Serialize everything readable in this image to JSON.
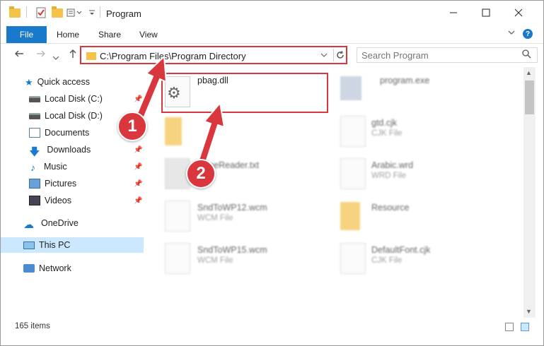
{
  "window": {
    "title": "Program"
  },
  "ribbon": {
    "file": "File",
    "tabs": [
      "Home",
      "Share",
      "View"
    ],
    "help": "?"
  },
  "address": {
    "path": "C:\\Program Files\\Program Directory",
    "search_placeholder": "Search Program"
  },
  "sidebar": {
    "items": [
      {
        "label": "Quick access",
        "icon": "star-icon"
      },
      {
        "label": "Local Disk (C:)",
        "icon": "drive-icon",
        "pinned": true
      },
      {
        "label": "Local Disk (D:)",
        "icon": "drive-icon"
      },
      {
        "label": "Documents",
        "icon": "documents-icon",
        "pinned": true
      },
      {
        "label": "Downloads",
        "icon": "download-icon",
        "pinned": true
      },
      {
        "label": "Music",
        "icon": "music-icon",
        "pinned": true
      },
      {
        "label": "Pictures",
        "icon": "pictures-icon",
        "pinned": true
      },
      {
        "label": "Videos",
        "icon": "videos-icon",
        "pinned": true
      },
      {
        "label": "OneDrive",
        "icon": "cloud-icon"
      },
      {
        "label": "This PC",
        "icon": "pc-icon",
        "selected": true
      },
      {
        "label": "Network",
        "icon": "network-icon"
      }
    ]
  },
  "files": [
    {
      "name": "pbag.dll",
      "type": ""
    },
    {
      "name": "program.exe",
      "type": ""
    },
    {
      "name": "",
      "type": ""
    },
    {
      "name": "gtd.cjk",
      "type": "CJK File"
    },
    {
      "name": "fineReader.txt",
      "type": ""
    },
    {
      "name": "Arabic.wrd",
      "type": "WRD File"
    },
    {
      "name": "SndToWP12.wcm",
      "type": "WCM File"
    },
    {
      "name": "Resource",
      "type": ""
    },
    {
      "name": "SndToWP15.wcm",
      "type": "WCM File"
    },
    {
      "name": "DefaultFont.cjk",
      "type": "CJK File"
    }
  ],
  "status": {
    "count": "165 items"
  },
  "annotations": {
    "step1": "1",
    "step2": "2"
  },
  "colors": {
    "accent": "#1979ca",
    "highlight": "#d9363e",
    "selected": "#cce8ff"
  }
}
